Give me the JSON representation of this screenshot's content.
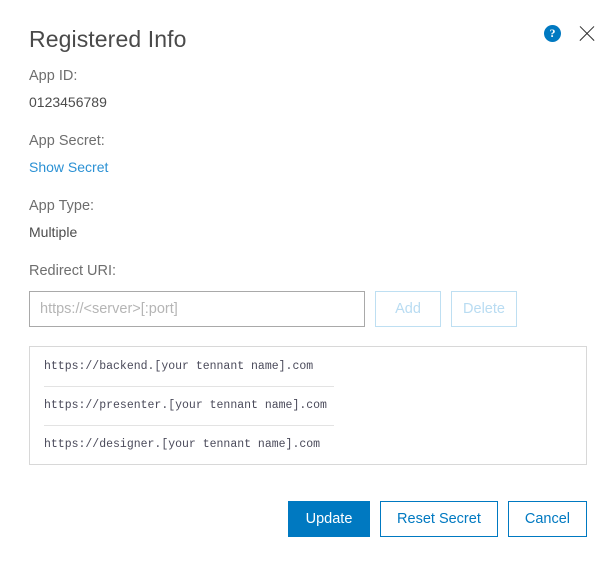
{
  "dialog": {
    "title": "Registered Info",
    "help_icon_label": "?",
    "close_icon_label": "",
    "accent_color": "#0079c1",
    "link_color": "#2b91d4",
    "disabled_color": "#b9dcf2"
  },
  "fields": [
    {
      "label": "App ID:",
      "value": "0123456789",
      "type": "text"
    },
    {
      "label": "App Secret:",
      "value": "Show Secret",
      "type": "link"
    },
    {
      "label": "App Type:",
      "value": "Multiple",
      "type": "text"
    }
  ],
  "redirect": {
    "label": "Redirect URI:",
    "input_value": "",
    "input_placeholder": "https://<server>[:port]",
    "add_label": "Add",
    "delete_label": "Delete",
    "items": [
      "https://backend.[your tennant name].com",
      "https://presenter.[your tennant name].com",
      "https://designer.[your tennant name].com"
    ]
  },
  "footer": {
    "update_label": "Update",
    "reset_secret_label": "Reset Secret",
    "cancel_label": "Cancel"
  }
}
